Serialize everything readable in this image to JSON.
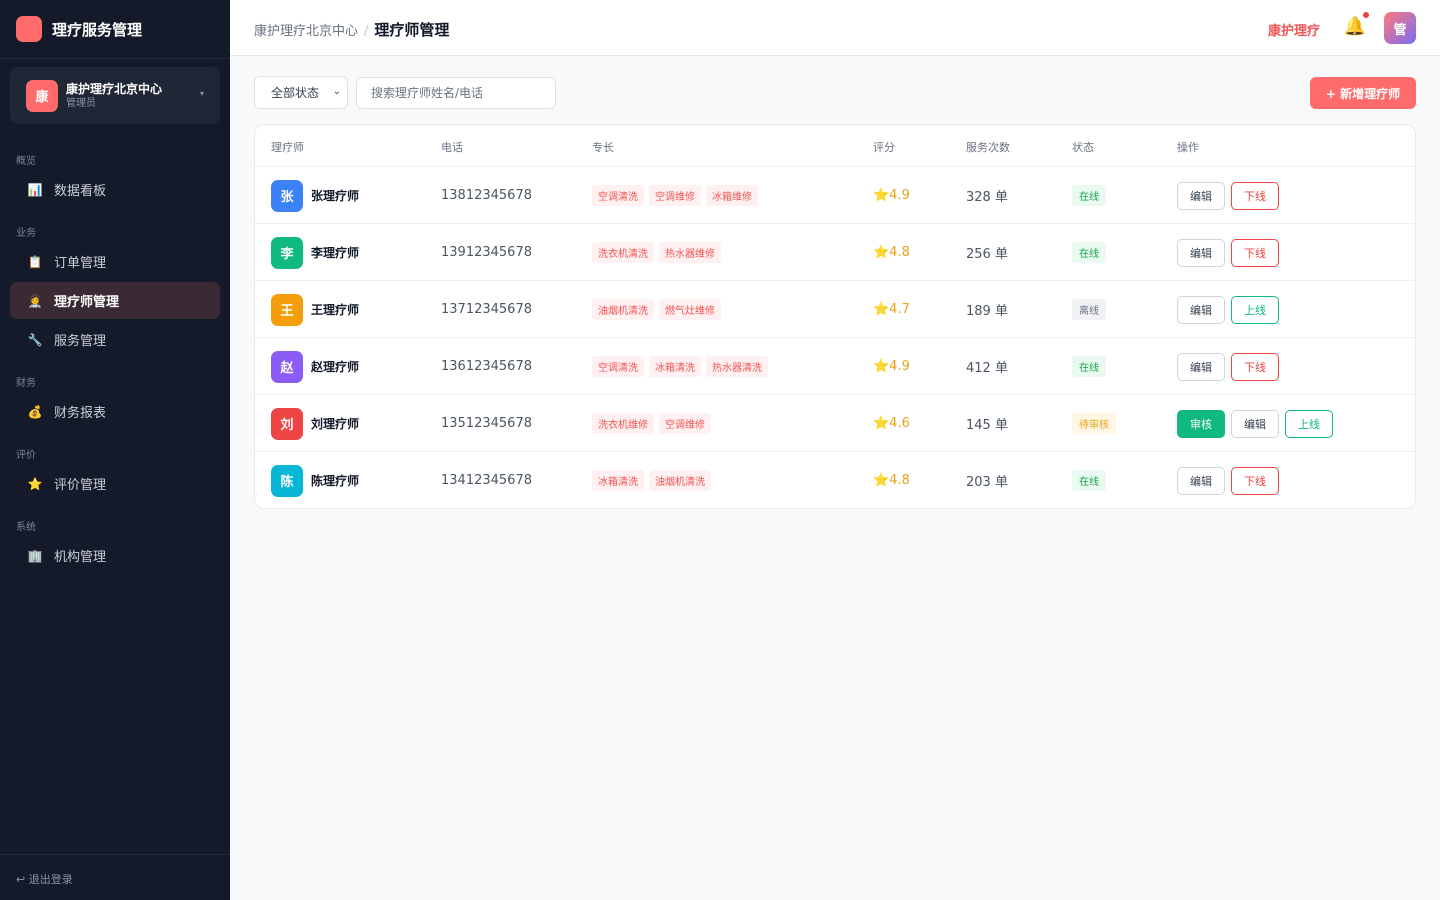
{
  "app": {
    "title": "理疗服务管理"
  },
  "org": {
    "avatar": "康",
    "name": "康护理疗北京中心",
    "role": "管理员",
    "caret": "▾"
  },
  "groups": {
    "overview": "概览",
    "business": "业务",
    "finance": "财务",
    "review": "评价",
    "system": "系统"
  },
  "nav": {
    "dashboard": {
      "icon": "📊",
      "label": "数据看板"
    },
    "orders": {
      "icon": "📋",
      "label": "订单管理"
    },
    "therapists": {
      "icon": "👩‍⚕️",
      "label": "理疗师管理"
    },
    "services": {
      "icon": "🔧",
      "label": "服务管理"
    },
    "reports": {
      "icon": "💰",
      "label": "财务报表"
    },
    "reviews": {
      "icon": "⭐",
      "label": "评价管理"
    },
    "orgs": {
      "icon": "🏢",
      "label": "机构管理"
    }
  },
  "logout": "↩ 退出登录",
  "header": {
    "crumb": "康护理疗北京中心",
    "sep": "/",
    "current": "理疗师管理",
    "brand": "康护理疗",
    "bell": "🔔",
    "avatar": "管"
  },
  "filters": {
    "status": "全部状态",
    "caret": "⌄",
    "search_placeholder": "搜索理疗师姓名/电话",
    "add_button": "+ 新增理疗师"
  },
  "table": {
    "headers": [
      "理疗师",
      "电话",
      "专长",
      "评分",
      "服务次数",
      "状态",
      "操作"
    ],
    "rows": [
      {
        "avatar": "张",
        "color": "#3b82f6",
        "name": "张理疗师",
        "phone": "13812345678",
        "tags": [
          "空调清洗",
          "空调维修",
          "冰箱维修"
        ],
        "rating": "⭐4.9",
        "count": "328 单",
        "status": "在线",
        "status_type": "online",
        "actions": [
          "编辑",
          "下线"
        ]
      },
      {
        "avatar": "李",
        "color": "#10b981",
        "name": "李理疗师",
        "phone": "13912345678",
        "tags": [
          "洗衣机清洗",
          "热水器维修"
        ],
        "rating": "⭐4.8",
        "count": "256 单",
        "status": "在线",
        "status_type": "online",
        "actions": [
          "编辑",
          "下线"
        ]
      },
      {
        "avatar": "王",
        "color": "#f59e0b",
        "name": "王理疗师",
        "phone": "13712345678",
        "tags": [
          "油烟机清洗",
          "燃气灶维修"
        ],
        "rating": "⭐4.7",
        "count": "189 单",
        "status": "离线",
        "status_type": "offline",
        "actions": [
          "编辑",
          "上线"
        ]
      },
      {
        "avatar": "赵",
        "color": "#8b5cf6",
        "name": "赵理疗师",
        "phone": "13612345678",
        "tags": [
          "空调清洗",
          "冰箱清洗",
          "热水器清洗"
        ],
        "rating": "⭐4.9",
        "count": "412 单",
        "status": "在线",
        "status_type": "online",
        "actions": [
          "编辑",
          "下线"
        ]
      },
      {
        "avatar": "刘",
        "color": "#ef4444",
        "name": "刘理疗师",
        "phone": "13512345678",
        "tags": [
          "洗衣机维修",
          "空调维修"
        ],
        "rating": "⭐4.6",
        "count": "145 单",
        "status": "待审核",
        "status_type": "pending",
        "actions": [
          "审核",
          "编辑",
          "上线"
        ]
      },
      {
        "avatar": "陈",
        "color": "#06b6d4",
        "name": "陈理疗师",
        "phone": "13412345678",
        "tags": [
          "冰箱清洗",
          "油烟机清洗"
        ],
        "rating": "⭐4.8",
        "count": "203 单",
        "status": "在线",
        "status_type": "online",
        "actions": [
          "编辑",
          "下线"
        ]
      }
    ]
  }
}
